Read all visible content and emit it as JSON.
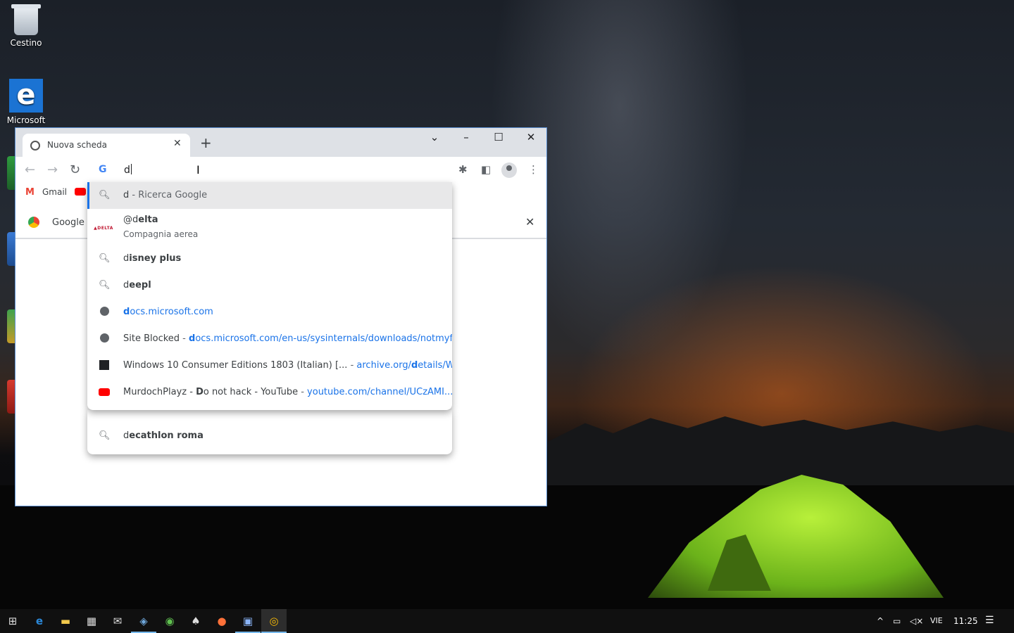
{
  "desktop": {
    "icons": [
      {
        "label": "Cestino"
      },
      {
        "label": "Microsoft"
      }
    ]
  },
  "browser": {
    "tab": {
      "title": "Nuova scheda",
      "close": "✕"
    },
    "new_tab": "+",
    "window_controls": {
      "tab_search": "⌄",
      "minimize": "–",
      "maximize": "☐",
      "close": "✕"
    },
    "nav": {
      "back": "←",
      "forward": "→",
      "reload": "↻"
    },
    "omnibox": {
      "logo": "G",
      "value": "d"
    },
    "toolbar_icons": {
      "extensions": "✱",
      "side_panel": "◧",
      "menu": "⋮"
    },
    "bookmarks": {
      "gmail_icon": "M",
      "gmail": "Gmail"
    },
    "infobar": {
      "text": "Google C",
      "close": "✕"
    }
  },
  "suggestions": [
    {
      "type": "search",
      "icon": "search-icon",
      "prefix": "d",
      "rest": "",
      "suffix": " - Ricerca Google",
      "selected": true
    },
    {
      "type": "entity",
      "icon": "delta-logo",
      "logo_text": "▲DELTA",
      "prefix": "@d",
      "rest": "elta",
      "sub": "Compagnia aerea"
    },
    {
      "type": "search",
      "icon": "search-icon",
      "prefix": "d",
      "rest": "isney plus"
    },
    {
      "type": "search",
      "icon": "search-icon",
      "prefix": "d",
      "rest": "eepl"
    },
    {
      "type": "url",
      "icon": "globe-icon",
      "url_prefix": "d",
      "url_rest": "ocs.microsoft.com"
    },
    {
      "type": "history",
      "icon": "globe-icon",
      "title": "Site Blocked",
      "sep": " - ",
      "url_prefix": "d",
      "url_rest": "ocs.microsoft.com/en-us/sysinternals/downloads/notmyf..."
    },
    {
      "type": "history",
      "icon": "archive-icon",
      "title": "Windows 10 Consumer Editions 1803 (Italian) [...",
      "sep": " - ",
      "url_pre": "archive.org/",
      "url_prefix": "d",
      "url_rest": "etails/W..."
    },
    {
      "type": "history",
      "icon": "youtube-icon",
      "title_pre": "MurdochPlayz - ",
      "title_bold": "D",
      "title_rest": "o not hack - YouTube",
      "sep": " - ",
      "url_rest": "youtube.com/channel/UCzAMI..."
    },
    {
      "type": "search",
      "icon": "search-icon",
      "prefix": "d",
      "rest": "ecathlon roma"
    }
  ],
  "taskbar": {
    "start": "⊞",
    "apps": [
      "edge",
      "file-explorer",
      "store",
      "mail",
      "virtualbox",
      "app-green",
      "solitaire",
      "firefox",
      "app-window",
      "chrome"
    ],
    "tray": {
      "chevron": "^",
      "language": "VIE",
      "time": "11:25",
      "notifications": "☰"
    }
  }
}
